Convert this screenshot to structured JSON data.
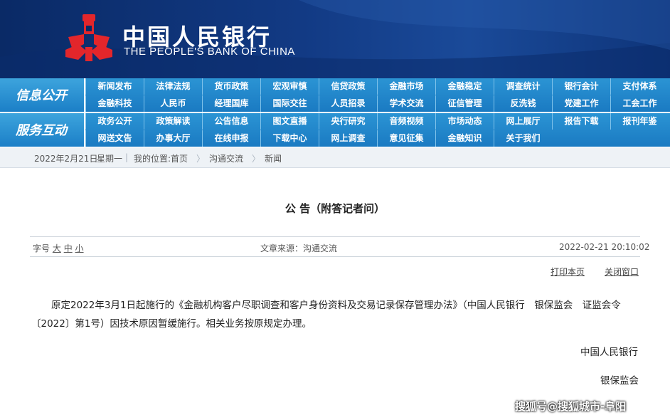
{
  "header": {
    "brand_cn": "中国人民银行",
    "brand_en": "THE PEOPLE'S BANK OF CHINA",
    "logo_icon": "pboc-logo-icon",
    "logo_color": "#e3262b"
  },
  "nav": {
    "row1_label": "信息公开",
    "row2_label": "服务互动",
    "row1_items": [
      [
        "新闻发布",
        "法律法规",
        "货币政策",
        "宏观审慎",
        "信贷政策",
        "金融市场",
        "金融稳定",
        "调查统计",
        "银行会计",
        "支付体系"
      ],
      [
        "金融科技",
        "人民币",
        "经理国库",
        "国际交往",
        "人员招录",
        "学术交流",
        "征信管理",
        "反洗钱",
        "党建工作",
        "工会工作"
      ]
    ],
    "row2_items": [
      [
        "政务公开",
        "政策解读",
        "公告信息",
        "图文直播",
        "央行研究",
        "音频视频",
        "市场动态",
        "网上展厅",
        "报告下载",
        "报刊年鉴"
      ],
      [
        "网送文告",
        "办事大厅",
        "在线申报",
        "下载中心",
        "网上调查",
        "意见征集",
        "金融知识",
        "关于我们"
      ]
    ]
  },
  "breadcrumb": {
    "date": "2022年2月21日",
    "weekday": "星期一",
    "location_label": "我的位置:",
    "home": "首页",
    "section": "沟通交流",
    "page": "新闻"
  },
  "article": {
    "title": "公 告（附答记者问）",
    "font_label": "字号",
    "font_large": "大",
    "font_medium": "中",
    "font_small": "小",
    "source": "文章来源：沟通交流",
    "datetime": "2022-02-21  20:10:02",
    "print": "打印本页",
    "close": "关闭窗口",
    "body": "原定2022年3月1日起施行的《金融机构客户尽职调查和客户身份资料及交易记录保存管理办法》（中国人民银行　银保监会　证监会令〔2022〕第1号）因技术原因暂缓施行。相关业务按原规定办理。",
    "signature_1": "中国人民银行",
    "signature_2": "银保监会"
  },
  "watermark": "搜狐号@搜狐城市-阜阳"
}
